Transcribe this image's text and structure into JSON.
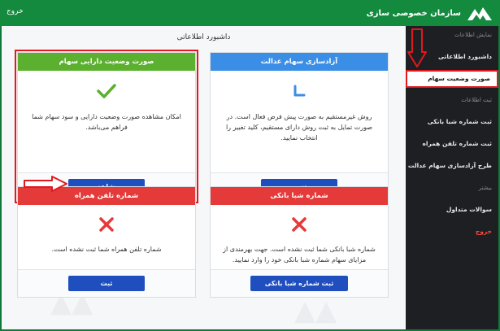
{
  "topbar": {
    "exit_label": "خروج",
    "brand_name": "سازمان خصوصی سازی"
  },
  "main": {
    "page_title": "داشبورد اطلاعاتی",
    "cards": [
      {
        "title": "صورت وضعیت دارایی سهام",
        "header_color": "#5cb030",
        "icon": "check-icon",
        "description": "امکان مشاهده صورت وضعیت دارایی و سود سهام شما فراهم می‌باشد.",
        "button_label": "مشاهده"
      },
      {
        "title": "آزادسازی سهام عدالت",
        "header_color": "#3a8ee6",
        "icon": "spinner-icon",
        "description": "روش غیرمستقیم به صورت پیش فرض فعال است. در صورت تمایل به ثبت روش دارای مستقیم، کلید تغییر را انتخاب نمایید.",
        "button_label": "تغییر"
      },
      {
        "title": "شماره تلفن همراه",
        "header_color": "#e53a3a",
        "icon": "cross-icon",
        "description": "شماره تلفن همراه شما ثبت نشده است.",
        "button_label": "ثبت"
      },
      {
        "title": "شماره شبا بانکی",
        "header_color": "#e53a3a",
        "icon": "cross-icon",
        "description": "شماره شبا بانکی شما ثبت نشده است. جهت بهرمندی از مزایای سهام شماره شبا بانکی خود را وارد نمایید.",
        "button_label": "ثبت شماره شبا بانکی"
      }
    ]
  },
  "sidebar": {
    "section_view": "نمایش اطلاعات",
    "item_dashboard": "داشبورد اطلاعاتی",
    "item_status": "صورت وضعیت سهام",
    "section_register": "ثبت اطلاعات",
    "item_sheba": "ثبت شماره شبا بانکی",
    "item_phone": "ثبت شماره تلفن همراه",
    "item_release": "طرح آزادسازی سهام عدالت",
    "section_more": "بیشتر",
    "item_faq": "سوالات متداول",
    "item_exit": "خروج"
  },
  "colors": {
    "topbar": "#138a3e",
    "sidebar": "#1d1f23",
    "button": "#1f4fbf",
    "highlight": "#e0191f"
  }
}
